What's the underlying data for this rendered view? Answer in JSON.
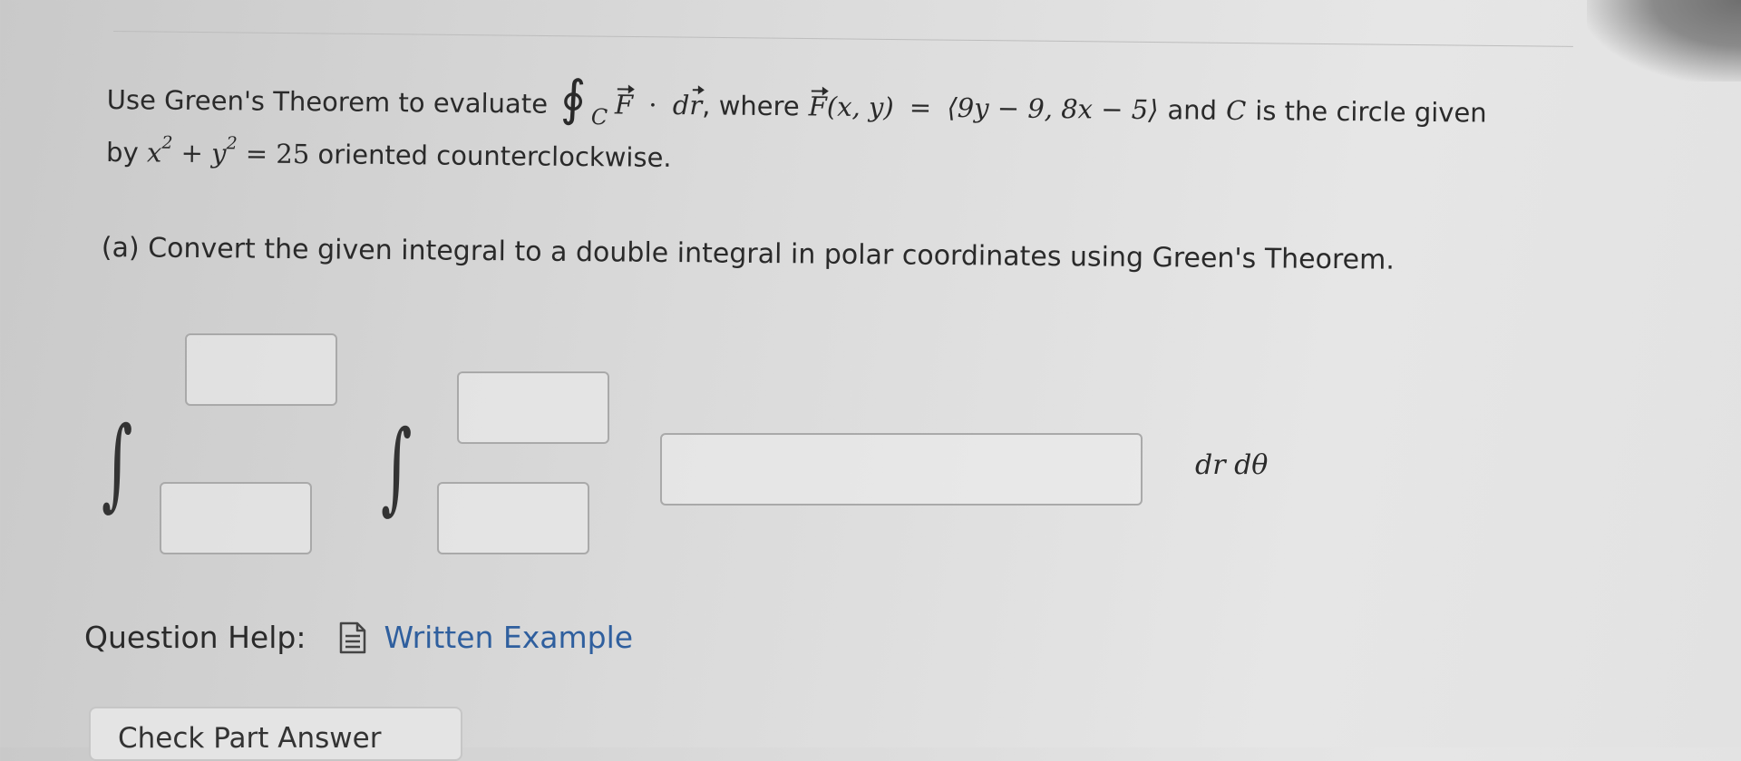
{
  "problem": {
    "intro": "Use Green's Theorem to evaluate",
    "integral_symbol": "∮",
    "integral_subscript": "C",
    "vector_F": "F",
    "dot": "·",
    "d": "d",
    "vector_r": "r",
    "where_text": ", where",
    "F_arg": "(x, y)",
    "equals": "=",
    "field_expression": "⟨9y − 9, 8x − 5⟩",
    "and_text": "and",
    "curve_name": "C",
    "circle_text": "is the circle given",
    "by_text": "by",
    "x_var": "x",
    "exp2": "2",
    "plus": "+",
    "y_var": "y",
    "rhs": "= 25",
    "orientation_text": "oriented counterclockwise."
  },
  "part_a": {
    "text": "(a) Convert the given integral to a double integral in polar coordinates using Green's Theorem."
  },
  "integral": {
    "outer_sign": "∫",
    "inner_sign": "∫",
    "differentials": "dr dθ"
  },
  "inputs": {
    "outer_upper": "",
    "outer_lower": "",
    "inner_upper": "",
    "inner_lower": "",
    "integrand": ""
  },
  "help": {
    "label": "Question Help:",
    "icon": "document-icon",
    "link_text": "Written Example"
  },
  "actions": {
    "check_button": "Check Part Answer"
  }
}
